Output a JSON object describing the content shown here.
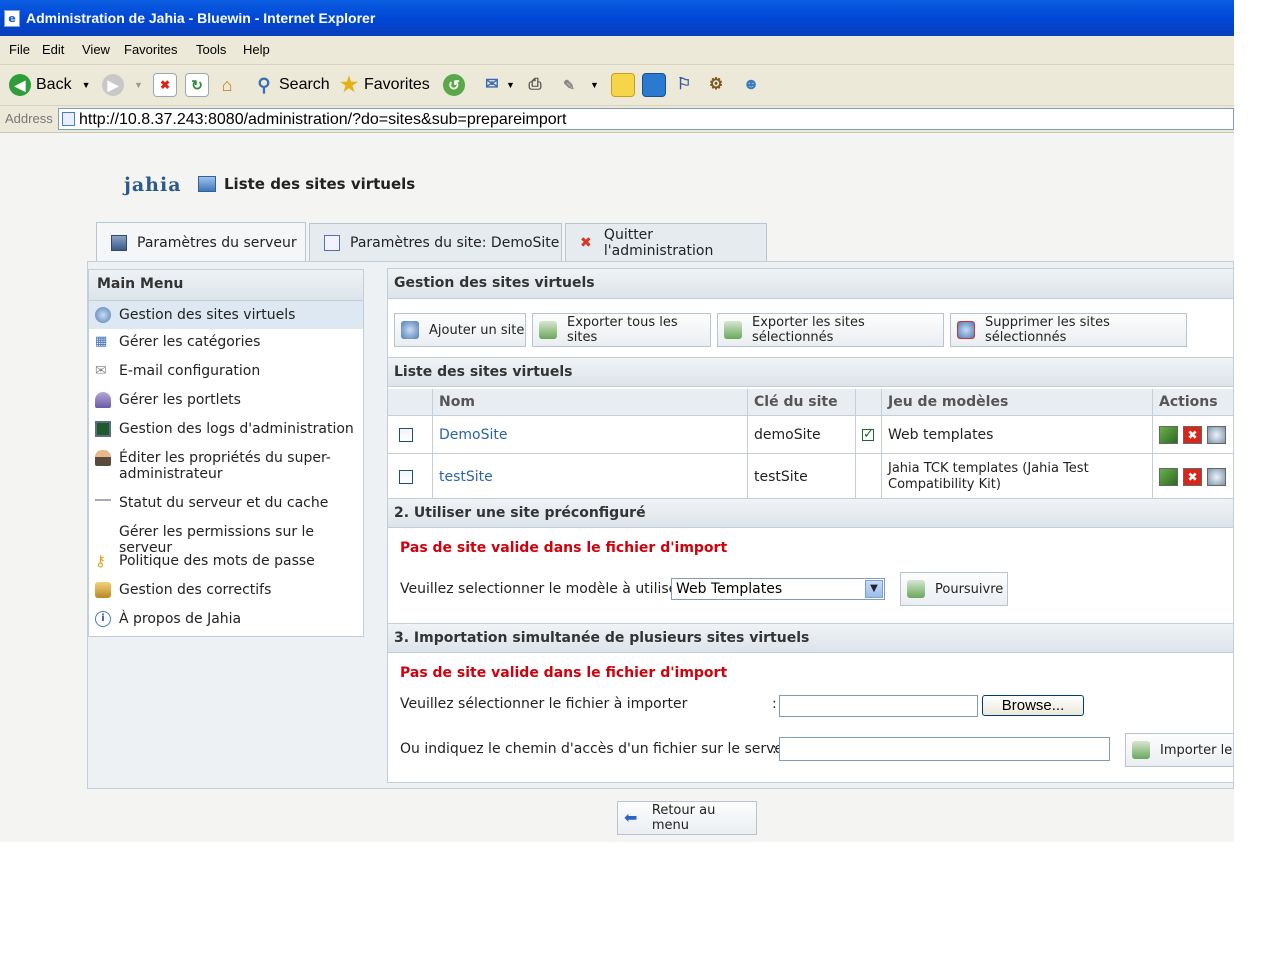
{
  "window": {
    "title": "Administration de Jahia - Bluewin - Internet Explorer"
  },
  "menubar": [
    "File",
    "Edit",
    "View",
    "Favorites",
    "Tools",
    "Help"
  ],
  "toolbar": {
    "back": "Back",
    "search": "Search",
    "favorites": "Favorites"
  },
  "address": {
    "label": "Address",
    "url": "http://10.8.37.243:8080/administration/?do=sites&sub=prepareimport"
  },
  "header": {
    "logo": "jahia",
    "title": "Liste des sites virtuels"
  },
  "tabs": [
    {
      "label": "Paramètres du serveur",
      "active": true
    },
    {
      "label": "Paramètres du site: DemoSite",
      "active": false
    },
    {
      "label": "Quitter l'administration",
      "active": false
    }
  ],
  "sidebar": {
    "title": "Main Menu",
    "items": [
      {
        "label": "Gestion des sites virtuels",
        "icon": "globe-icon",
        "selected": true
      },
      {
        "label": "Gérer les catégories",
        "icon": "tree-icon"
      },
      {
        "label": "E-mail configuration",
        "icon": "envelope-icon"
      },
      {
        "label": "Gérer les portlets",
        "icon": "portlet-icon"
      },
      {
        "label": "Gestion des logs d'administration",
        "icon": "monitor-icon"
      },
      {
        "label": "Éditer les propriétés du super-administrateur",
        "icon": "user-icon"
      },
      {
        "label": "Statut du serveur et du cache",
        "icon": "server-icon"
      },
      {
        "label": "Gérer les permissions sur le serveur",
        "icon": ""
      },
      {
        "label": "Politique des mots de passe",
        "icon": "key-icon"
      },
      {
        "label": "Gestion des correctifs",
        "icon": "patch-icon"
      },
      {
        "label": "À propos de Jahia",
        "icon": "info-icon"
      }
    ]
  },
  "main": {
    "title": "Gestion des sites virtuels",
    "buttons": [
      "Ajouter un site",
      "Exporter tous les sites",
      "Exporter les sites sélectionnés",
      "Supprimer les sites sélectionnés"
    ],
    "list_title": "Liste des sites virtuels",
    "columns": [
      "",
      "Nom",
      "Clé du site",
      "",
      "Jeu de modèles",
      "Actions"
    ],
    "rows": [
      {
        "name": "DemoSite",
        "key": "demoSite",
        "default": true,
        "templates": "Web templates"
      },
      {
        "name": "testSite",
        "key": "testSite",
        "default": false,
        "templates": "Jahia TCK templates (Jahia Test Compatibility Kit)"
      }
    ],
    "section2": {
      "title": "2. Utiliser une site préconfiguré",
      "error": "Pas de site valide dans le fichier d'import",
      "label": "Veuillez selectionner le modèle à utiliser",
      "select_value": "Web Templates",
      "button": "Poursuivre"
    },
    "section3": {
      "title": "3. Importation simultanée de plusieurs sites virtuels",
      "error": "Pas de site valide dans le fichier d'import",
      "file_label": "Veuillez sélectionner le fichier à importer",
      "colon": ":",
      "browse": "Browse...",
      "path_label": "Ou indiquez le chemin d'accès d'un fichier sur le serveur",
      "import_button": "Importer le fic"
    }
  },
  "footer": {
    "back_button": "Retour au menu"
  },
  "colors": {
    "link": "#2a64a6",
    "error": "#d0000d",
    "titlebar": "#0054e3"
  }
}
